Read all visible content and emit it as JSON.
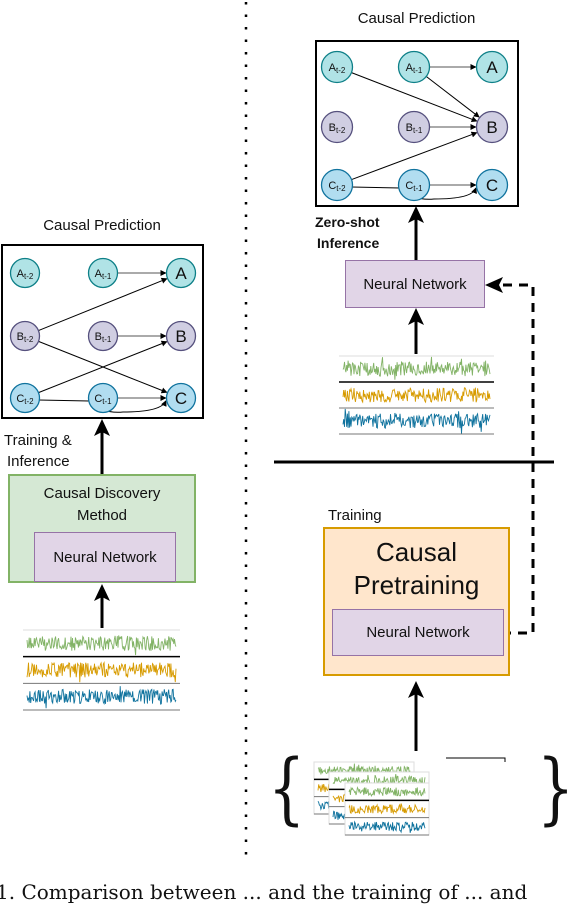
{
  "colors": {
    "node_a": "#b0e3e6",
    "node_a_stroke": "#0e8088",
    "node_b": "#d0cee2",
    "node_b_stroke": "#56517e",
    "node_c": "#b1ddf0",
    "node_c_stroke": "#10739e",
    "series": [
      "#82b366",
      "#d79b00",
      "#10739e"
    ],
    "nn_fill": "#e1d5e7",
    "green_fill": "#d5e8d4",
    "orange_fill": "#ffe6cc"
  },
  "left_panel": {
    "title": "Causal Prediction",
    "arrow_label_line1": "Training &",
    "arrow_label_line2": "Inference",
    "method_box": {
      "title_line1": "Causal Discovery",
      "title_line2": "Method",
      "inner_label": "Neural Network"
    },
    "graph": {
      "nodes": [
        {
          "id": "At2",
          "base": "A",
          "sub": "t-2",
          "var": "a"
        },
        {
          "id": "At1",
          "base": "A",
          "sub": "t-1",
          "var": "a"
        },
        {
          "id": "A",
          "base": "A",
          "sub": "",
          "var": "a"
        },
        {
          "id": "Bt2",
          "base": "B",
          "sub": "t-2",
          "var": "b"
        },
        {
          "id": "Bt1",
          "base": "B",
          "sub": "t-1",
          "var": "b"
        },
        {
          "id": "B",
          "base": "B",
          "sub": "",
          "var": "b"
        },
        {
          "id": "Ct2",
          "base": "C",
          "sub": "t-2",
          "var": "c"
        },
        {
          "id": "Ct1",
          "base": "C",
          "sub": "t-1",
          "var": "c"
        },
        {
          "id": "C",
          "base": "C",
          "sub": "",
          "var": "c"
        }
      ],
      "self_edges": [
        [
          "At1",
          "A"
        ],
        [
          "Bt1",
          "B"
        ],
        [
          "Ct1",
          "C"
        ]
      ],
      "causal_edges": [
        [
          "Bt2",
          "A"
        ],
        [
          "Bt2",
          "C"
        ],
        [
          "Ct2",
          "B"
        ],
        [
          "Ct2",
          "C"
        ]
      ]
    }
  },
  "right_panel": {
    "title": "Causal Prediction",
    "arrow_label_line1": "Zero-shot",
    "arrow_label_line2": "Inference",
    "inference_nn_label": "Neural Network",
    "training_label": "Training",
    "pretraining_box": {
      "title_line1": "Causal",
      "title_line2": "Pretraining",
      "inner_label": "Neural Network"
    },
    "graph": {
      "nodes": [
        {
          "id": "At2",
          "base": "A",
          "sub": "t-2",
          "var": "a"
        },
        {
          "id": "At1",
          "base": "A",
          "sub": "t-1",
          "var": "a"
        },
        {
          "id": "A",
          "base": "A",
          "sub": "",
          "var": "a"
        },
        {
          "id": "Bt2",
          "base": "B",
          "sub": "t-2",
          "var": "b"
        },
        {
          "id": "Bt1",
          "base": "B",
          "sub": "t-1",
          "var": "b"
        },
        {
          "id": "B",
          "base": "B",
          "sub": "",
          "var": "b"
        },
        {
          "id": "Ct2",
          "base": "C",
          "sub": "t-2",
          "var": "c"
        },
        {
          "id": "Ct1",
          "base": "C",
          "sub": "t-1",
          "var": "c"
        },
        {
          "id": "C",
          "base": "C",
          "sub": "",
          "var": "c"
        }
      ],
      "self_edges": [
        [
          "At1",
          "A"
        ],
        [
          "Bt1",
          "B"
        ],
        [
          "Ct1",
          "C"
        ]
      ],
      "causal_edges": [
        [
          "At2",
          "B"
        ],
        [
          "At1",
          "B"
        ],
        [
          "Ct2",
          "B"
        ],
        [
          "Ct2",
          "C"
        ]
      ]
    },
    "dataset_braces": {
      "open": "{",
      "close": "}"
    }
  },
  "caption_fragment": "1. Comparison between ... and the training of ... and"
}
